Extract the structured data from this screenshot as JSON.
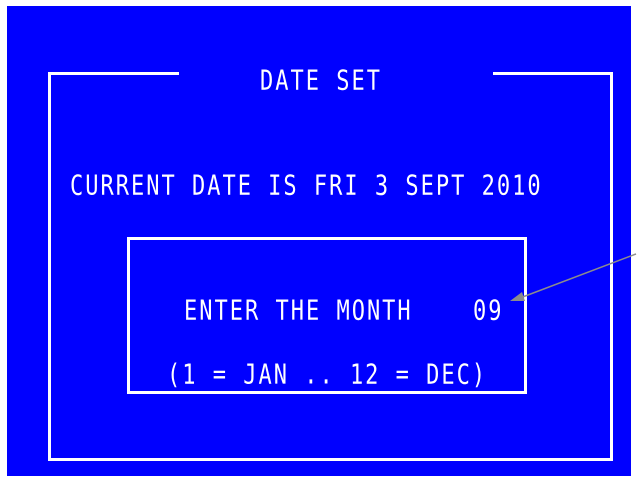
{
  "dialog": {
    "title": "DATE SET",
    "current_date_line": "CURRENT DATE IS FRI 3 SEPT 2010"
  },
  "prompt": {
    "label": "ENTER THE MONTH",
    "value": "09",
    "hint": "(1 = JAN .. 12 = DEC)"
  },
  "colors": {
    "screen_background": "#0000ff",
    "text": "#ffffff",
    "annotation_arrow": "#8c8c8c"
  },
  "icons": {
    "annotation": "arrow-pointer-icon"
  }
}
